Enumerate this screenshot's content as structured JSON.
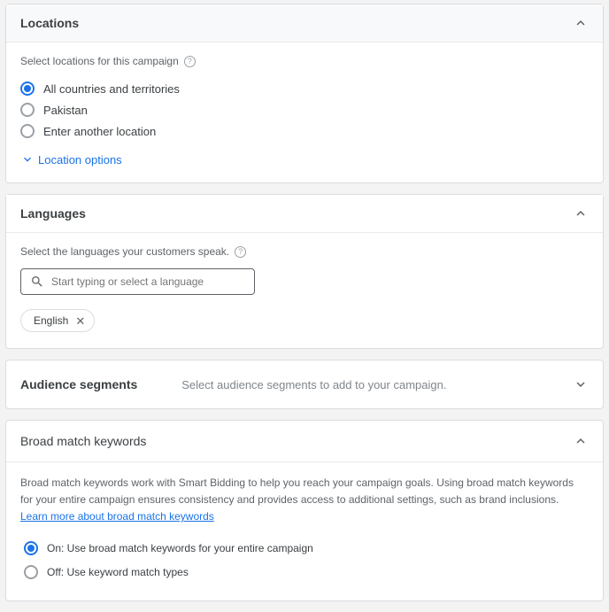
{
  "locations": {
    "title": "Locations",
    "subtitle": "Select locations for this campaign",
    "options": {
      "all": "All countries and territories",
      "pk": "Pakistan",
      "other": "Enter another location"
    },
    "location_options": "Location options"
  },
  "languages": {
    "title": "Languages",
    "subtitle": "Select the languages your customers speak.",
    "placeholder": "Start typing or select a language",
    "chip": "English"
  },
  "audience": {
    "title": "Audience segments",
    "subtitle": "Select audience segments to add to your campaign."
  },
  "broadmatch": {
    "title": "Broad match keywords",
    "desc_prefix": "Broad match keywords work with Smart Bidding to help you reach your campaign goals. Using broad match keywords for your entire campaign ensures consistency and provides access to additional settings, such as brand inclusions. ",
    "learn_more": "Learn more about broad match keywords",
    "opt_on": "On: Use broad match keywords for your entire campaign",
    "opt_off": "Off: Use keyword match types"
  }
}
